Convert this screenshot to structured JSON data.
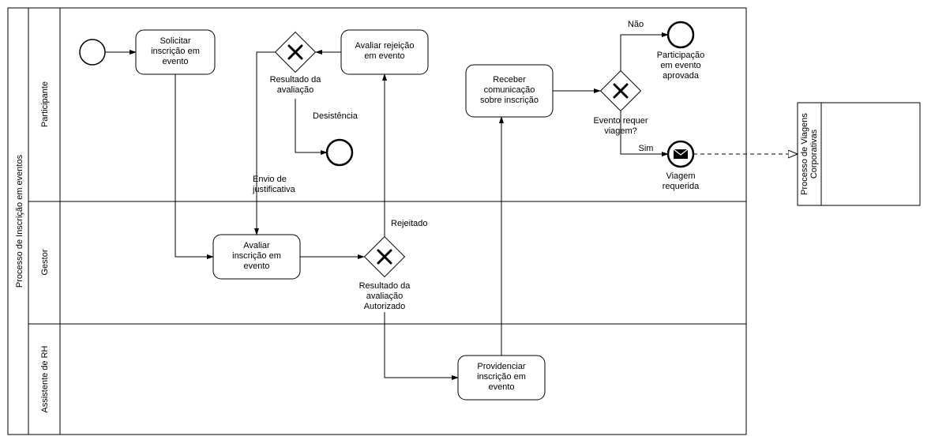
{
  "pool": {
    "main_label": "Processo de Inscrição em eventos",
    "lanes": [
      {
        "label": "Participante"
      },
      {
        "label": "Gestor"
      },
      {
        "label": "Assistente de RH"
      }
    ]
  },
  "external_pool": {
    "label": "Processo de Viagens Corporativas"
  },
  "tasks": {
    "solicitar": "Solicitar\ninscrição em\nevento",
    "avaliar_rej": "Avaliar rejeição\nem evento",
    "receber": "Receber\ncomunicação\nsobre inscrição",
    "avaliar_insc": "Avaliar\ninscrição em\nevento",
    "providenciar": "Providenciar\ninscrição em\nevento"
  },
  "gateways": {
    "g1_label": "Resultado da\navaliação",
    "g2_label": "Resultado da\navaliação",
    "g2_label2": "Autorizado",
    "g3_label": "Evento requer\nviagem?"
  },
  "edges": {
    "desistencia": "Desistência",
    "envio": "Envio de\njustificativa",
    "rejeitado": "Rejeitado",
    "nao": "Não",
    "sim": "Sim"
  },
  "ends": {
    "approved": "Participação\nem evento\naprovada",
    "trip": "Viagem\nrequerida"
  }
}
